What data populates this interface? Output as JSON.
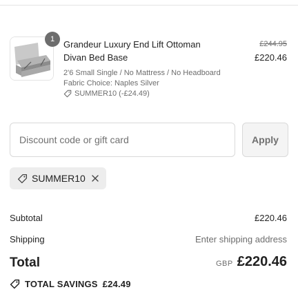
{
  "product": {
    "quantity": "1",
    "title": "Grandeur Luxury End Lift Ottoman Divan Bed Base",
    "original_price": "£244.95",
    "price": "£220.46",
    "variant": "2'6 Small Single / No Mattress / No Headboard",
    "fabric": "Fabric Choice: Naples Silver",
    "line_discount": "SUMMER10 (-£24.49)"
  },
  "discount": {
    "placeholder": "Discount code or gift card",
    "apply_label": "Apply",
    "applied_code": "SUMMER10"
  },
  "summary": {
    "subtotal_label": "Subtotal",
    "subtotal_value": "£220.46",
    "shipping_label": "Shipping",
    "shipping_value": "Enter shipping address",
    "total_label": "Total",
    "currency": "GBP",
    "total_value": "£220.46",
    "savings_label": "TOTAL SAVINGS",
    "savings_value": "£24.49"
  },
  "colors": {
    "text": "#222222",
    "muted": "#6d6d6d",
    "border": "#d9d9d9",
    "chip_bg": "#ededed",
    "badge_bg": "#6d6d6d"
  },
  "icons": [
    "tag-icon",
    "close-icon",
    "product-thumbnail"
  ]
}
